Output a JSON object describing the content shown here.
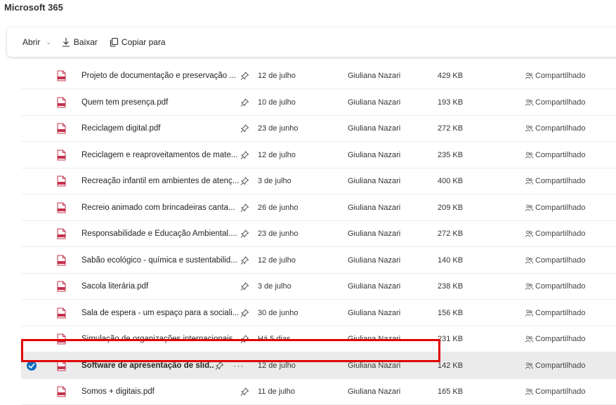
{
  "app": {
    "title": "Microsoft 365"
  },
  "toolbar": {
    "open_label": "Abrir",
    "download_label": "Baixar",
    "copy_label": "Copiar para"
  },
  "colors": {
    "accent": "#0f6cbd",
    "pdf_red": "#c4314b",
    "highlight": "#e00000"
  },
  "files": [
    {
      "name": "Projeto de documentação e preservação ...",
      "date": "12 de julho",
      "owner": "Giuliana Nazari",
      "size": "429 KB",
      "sharing": "Compartilhado",
      "selected": false
    },
    {
      "name": "Quem tem presença.pdf",
      "date": "10 de julho",
      "owner": "Giuliana Nazari",
      "size": "193 KB",
      "sharing": "Compartilhado",
      "selected": false
    },
    {
      "name": "Reciclagem digital.pdf",
      "date": "23 de junho",
      "owner": "Giuliana Nazari",
      "size": "272 KB",
      "sharing": "Compartilhado",
      "selected": false
    },
    {
      "name": "Reciclagem e reaproveitamentos de mate...",
      "date": "12 de julho",
      "owner": "Giuliana Nazari",
      "size": "235 KB",
      "sharing": "Compartilhado",
      "selected": false
    },
    {
      "name": "Recreação infantil em ambientes de atenç...",
      "date": "3 de julho",
      "owner": "Giuliana Nazari",
      "size": "400 KB",
      "sharing": "Compartilhado",
      "selected": false
    },
    {
      "name": "Recreio animado com brincadeiras canta...",
      "date": "26 de junho",
      "owner": "Giuliana Nazari",
      "size": "209 KB",
      "sharing": "Compartilhado",
      "selected": false
    },
    {
      "name": "Responsabilidade e Educação Ambiental....",
      "date": "23 de junho",
      "owner": "Giuliana Nazari",
      "size": "272 KB",
      "sharing": "Compartilhado",
      "selected": false
    },
    {
      "name": "Sabão ecológico - química e sustentabilid...",
      "date": "12 de julho",
      "owner": "Giuliana Nazari",
      "size": "140 KB",
      "sharing": "Compartilhado",
      "selected": false
    },
    {
      "name": "Sacola literária.pdf",
      "date": "3 de julho",
      "owner": "Giuliana Nazari",
      "size": "238 KB",
      "sharing": "Compartilhado",
      "selected": false
    },
    {
      "name": "Sala de espera - um espaço para a sociali...",
      "date": "30 de junho",
      "owner": "Giuliana Nazari",
      "size": "156 KB",
      "sharing": "Compartilhado",
      "selected": false
    },
    {
      "name": "Simulação de organizações internacionais...",
      "date": "Há 5 dias",
      "owner": "Giuliana Nazari",
      "size": "231 KB",
      "sharing": "Compartilhado",
      "selected": false
    },
    {
      "name": "Software de apresentação de slid...",
      "date": "12 de julho",
      "owner": "Giuliana Nazari",
      "size": "142 KB",
      "sharing": "Compartilhado",
      "selected": true
    },
    {
      "name": "Somos + digitais.pdf",
      "date": "11 de julho",
      "owner": "Giuliana Nazari",
      "size": "165 KB",
      "sharing": "Compartilhado",
      "selected": false
    }
  ]
}
